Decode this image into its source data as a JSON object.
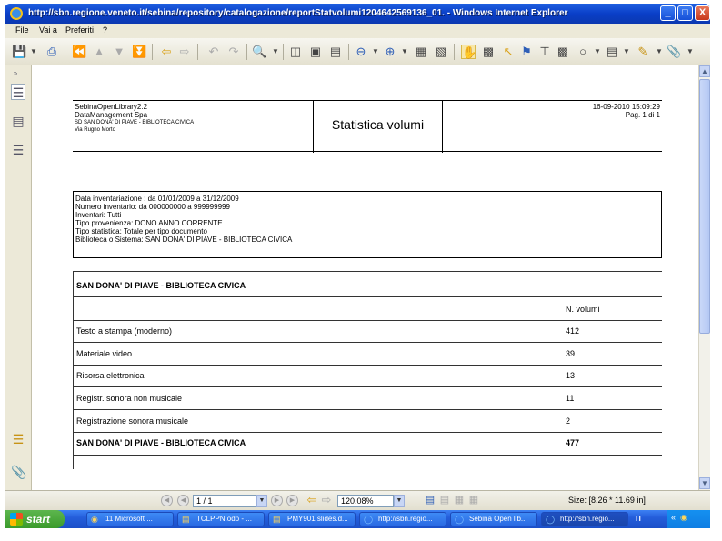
{
  "window": {
    "title": "http://sbn.regione.veneto.it/sebina/repository/catalogazione/reportStatvolumi1204642569136_01. - Windows Internet Explorer",
    "minimize": "_",
    "maximize": "□",
    "close": "X"
  },
  "menu": {
    "items": [
      "File",
      "Vai a",
      "Preferiti",
      "?"
    ]
  },
  "report": {
    "header": {
      "left_lines": [
        "SebinaOpenLibrary2.2",
        "DataManagement Spa"
      ],
      "left_small": [
        "SD SAN DONA' DI PIAVE - BIBLIOTECA CIVICA",
        "Via Rugno Morto"
      ],
      "title": "Statistica volumi",
      "datetime": "16-09-2010 15:09:29",
      "page": "Pag. 1 di 1"
    },
    "params": [
      "Data inventariazione : da  01/01/2009  a  31/12/2009",
      "Numero inventario: da  000000000  a    999999999",
      "Inventari: Tutti",
      "Tipo provenienza: DONO ANNO CORRENTE",
      "Tipo statistica: Totale per tipo documento",
      "Biblioteca o Sistema: SAN DONA' DI PIAVE - BIBLIOTECA CIVICA"
    ],
    "table": {
      "library_heading": "SAN DONA' DI PIAVE - BIBLIOTECA CIVICA",
      "column_header": "N. volumi",
      "rows": [
        {
          "label": "Testo a stampa (moderno)",
          "value": "412"
        },
        {
          "label": "Materiale video",
          "value": "39"
        },
        {
          "label": "Risorsa elettronica",
          "value": "13"
        },
        {
          "label": "Registr. sonora non musicale",
          "value": "11"
        },
        {
          "label": "Registrazione sonora musicale",
          "value": "2"
        }
      ],
      "total_label": "SAN DONA' DI PIAVE - BIBLIOTECA CIVICA",
      "total_value": "477"
    }
  },
  "navbar": {
    "page_field": "1 / 1",
    "zoom_field": "120.08%",
    "size_text": "Size: [8.26 * 11.69 in]"
  },
  "taskbar": {
    "start": "start",
    "tasks": [
      "11 Microsoft ...",
      "TCLPPN.odp - ...",
      "PMY901 slides.d...",
      "http://sbn.regio...",
      "Sebina Open lib...",
      "http://sbn.regio..."
    ],
    "lang": "IT"
  },
  "icons": {
    "toolbar": [
      "save-icon",
      "print-icon",
      "first-page-icon",
      "prev-page-icon",
      "next-page-icon",
      "last-page-icon",
      "back-icon",
      "forward-icon",
      "rotate-left-icon",
      "rotate-right-icon",
      "zoom-icon",
      "actual-size-icon",
      "fit-page-icon",
      "fit-width-icon",
      "zoom-out-icon",
      "zoom-in-icon",
      "thumbnails-icon",
      "multipage-icon",
      "hand-icon",
      "select-icon",
      "pointer-icon",
      "binoculars-icon",
      "text-icon",
      "image-icon",
      "circle-icon",
      "note-icon",
      "pencil-icon",
      "attach-icon"
    ]
  }
}
